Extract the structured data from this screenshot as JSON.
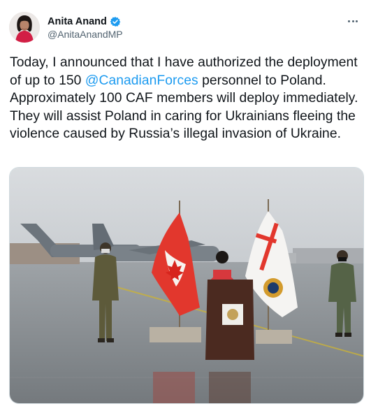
{
  "tweet": {
    "author": {
      "display_name": "Anita Anand",
      "handle": "@AnitaAnandMP",
      "verified": true,
      "avatar_icon": "profile-photo"
    },
    "more_icon": "more-options-icon",
    "text": {
      "part1": "Today, I announced that I have authorized the deployment of up to 150 ",
      "mention": "@CanadianForces",
      "part2": " personnel to Poland. Approximately 100 CAF members will deploy immediately. They will assist Poland in caring for Ukrainians fleeing the violence caused by Russia’s illegal invasion of Ukraine."
    },
    "media": {
      "type": "photo"
    }
  },
  "colors": {
    "link": "#1d9bf0",
    "secondary_text": "#536471",
    "primary_text": "#0f1419",
    "verified_badge": "#1d9bf0"
  }
}
